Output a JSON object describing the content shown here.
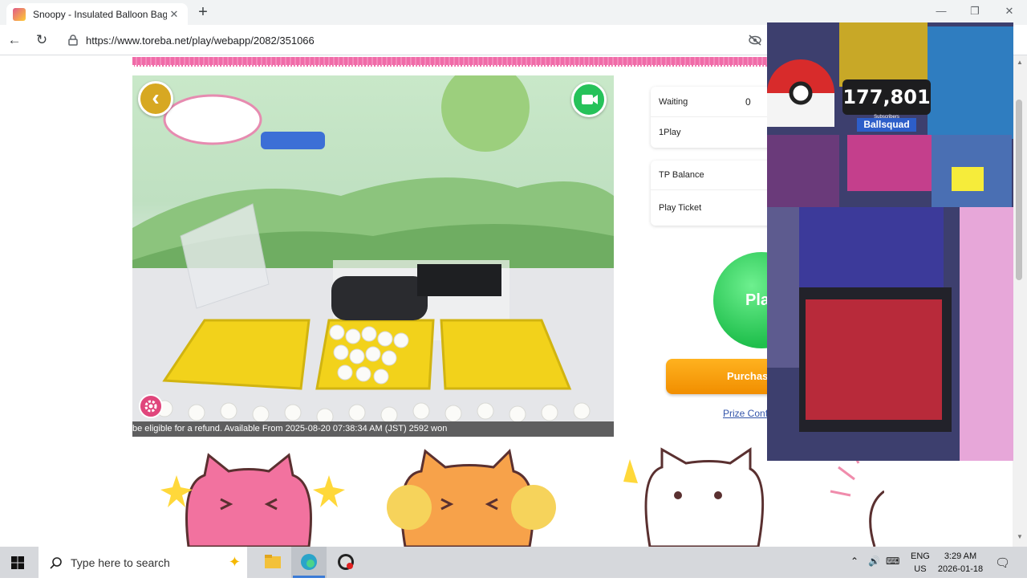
{
  "browser": {
    "tab_title": "Snoopy - Insulated Balloon Bag S",
    "url": "https://www.toreba.net/play/webapp/2082/351066",
    "new_tab_label": "+",
    "close_label": "✕"
  },
  "game": {
    "ticker_text": "be eligible for a refund. Available From 2025-08-20 07:38:34 AM (JST) 2592 won",
    "back_label": "‹"
  },
  "status_card": {
    "waiting_label": "Waiting",
    "waiting_value": "0",
    "play_label": "1Play"
  },
  "balance_card": {
    "tp_label": "TP Balance",
    "ticket_label": "Play Ticket"
  },
  "actions": {
    "play_label": "Pla",
    "purchase_label": "Purchas",
    "prize_link": "Prize Confi"
  },
  "overlay": {
    "subscriber_count": "177,801",
    "subscriber_label": "Subscribers",
    "channel_name": "Ballsquad"
  },
  "taskbar": {
    "search_placeholder": "Type here to search",
    "lang_top": "ENG",
    "lang_bottom": "US",
    "time": "3:29 AM",
    "date": "2026-01-18"
  },
  "colors": {
    "accent_pink": "#f06ba8",
    "play_green": "#1fbf4c",
    "purchase_orange": "#f18e00"
  }
}
